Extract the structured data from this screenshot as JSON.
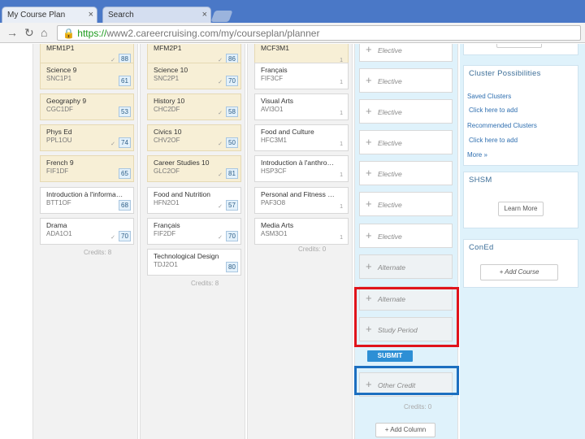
{
  "browser": {
    "tabs": [
      {
        "label": "My Course Plan"
      },
      {
        "label": "Search"
      }
    ],
    "url_protocol": "https://",
    "url_rest": "www2.careercruising.com/my/courseplan/planner"
  },
  "columns": {
    "grade9": {
      "cards": [
        {
          "title": "MFM1P1",
          "code": "",
          "grade": "88"
        },
        {
          "title": "Science 9",
          "code": "SNC1P1",
          "grade": "61"
        },
        {
          "title": "Geography 9",
          "code": "CGC1DF",
          "grade": "53"
        },
        {
          "title": "Phys Ed",
          "code": "PPL1OU",
          "grade": "74"
        },
        {
          "title": "French 9",
          "code": "FIF1DF",
          "grade": "65"
        },
        {
          "title": "Introduction à l'informa…",
          "code": "BTT1OF",
          "grade": "68"
        },
        {
          "title": "Drama",
          "code": "ADA1O1",
          "grade": "70"
        }
      ],
      "credits": "Credits: 8"
    },
    "grade10": {
      "cards": [
        {
          "title": "MFM2P1",
          "code": "",
          "grade": "86"
        },
        {
          "title": "Science 10",
          "code": "SNC2P1",
          "grade": "70"
        },
        {
          "title": "History 10",
          "code": "CHC2DF",
          "grade": "58"
        },
        {
          "title": "Civics 10",
          "code": "CHV2OF",
          "grade": "50"
        },
        {
          "title": "Career Studies 10",
          "code": "GLC2OF",
          "grade": "81"
        },
        {
          "title": "Food and Nutrition",
          "code": "HFN2O1",
          "grade": "57"
        },
        {
          "title": "Français",
          "code": "FIF2DF",
          "grade": "70"
        },
        {
          "title": "Technological Design",
          "code": "TDJ2O1",
          "grade": "80"
        }
      ],
      "credits": "Credits: 8"
    },
    "grade11": {
      "cards": [
        {
          "title": "MCF3M1",
          "code": "",
          "grade": "1"
        },
        {
          "title": "Français",
          "code": "FIF3CF",
          "grade": "1"
        },
        {
          "title": "Visual Arts",
          "code": "AVI3O1",
          "grade": "1"
        },
        {
          "title": "Food and Culture",
          "code": "HFC3M1",
          "grade": "1"
        },
        {
          "title": "Introduction à l'anthro…",
          "code": "HSP3CF",
          "grade": "1"
        },
        {
          "title": "Personal and Fitness …",
          "code": "PAF3O8",
          "grade": "1"
        },
        {
          "title": "Media Arts",
          "code": "ASM3O1",
          "grade": "1"
        }
      ],
      "credits": "Credits: 0"
    },
    "grade12": {
      "slots": [
        "Elective",
        "Elective",
        "Elective",
        "Elective",
        "Elective",
        "Elective",
        "Elective"
      ],
      "alternate": "Alternate",
      "red_slots": [
        "Alternate",
        "Study Period"
      ],
      "submit": "SUBMIT",
      "other_credit": "Other Credit",
      "credits": "Credits: 0",
      "add_column": "Add Column"
    }
  },
  "sidebar": {
    "cluster": {
      "title": "Cluster Possibilities",
      "saved": "Saved Clusters",
      "saved_link": "Click here to add",
      "recommended": "Recommended Clusters",
      "recommended_link": "Click here to add",
      "more": "More »"
    },
    "shsm": {
      "title": "SHSM",
      "button": "Learn More"
    },
    "coned": {
      "title": "ConEd",
      "button": "Add Course"
    }
  },
  "colors": {
    "red_highlight": "#e0141b",
    "blue_highlight": "#1c6fc0",
    "submit": "#2d8fd5"
  }
}
